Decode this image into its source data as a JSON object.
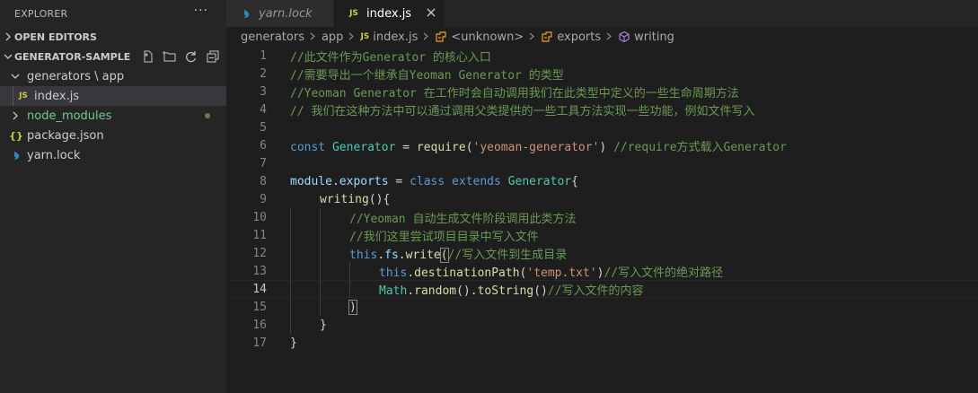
{
  "explorer": {
    "title": "EXPLORER",
    "more_label": "···",
    "open_editors_label": "OPEN EDITORS",
    "project_label": "GENERATOR-SAMPLE",
    "tree": {
      "generators_folder": "generators \\ app",
      "index_file": "index.js",
      "node_modules": "node_modules",
      "package_json": "package.json",
      "yarn_lock": "yarn.lock"
    }
  },
  "tabs": [
    {
      "label": "yarn.lock"
    },
    {
      "label": "index.js"
    }
  ],
  "breadcrumbs": {
    "generators": "generators",
    "app": "app",
    "file": "index.js",
    "unknown": "<unknown>",
    "exports": "exports",
    "writing": "writing"
  },
  "editor": {
    "current_line": 14,
    "lines": [
      {
        "n": "1"
      },
      {
        "n": "2"
      },
      {
        "n": "3"
      },
      {
        "n": "4"
      },
      {
        "n": "5"
      },
      {
        "n": "6"
      },
      {
        "n": "7"
      },
      {
        "n": "8"
      },
      {
        "n": "9"
      },
      {
        "n": "10"
      },
      {
        "n": "11"
      },
      {
        "n": "12"
      },
      {
        "n": "13"
      },
      {
        "n": "14"
      },
      {
        "n": "15"
      },
      {
        "n": "16"
      },
      {
        "n": "17"
      }
    ],
    "code": {
      "l1": "//此文件作为Generator 的核心入口",
      "l2": "//需要导出一个继承自Yeoman Generator 的类型",
      "l3": "//Yeoman Generator 在工作时会自动调用我们在此类型中定义的一些生命周期方法",
      "l4": "// 我们在这种方法中可以通过调用父类提供的一些工具方法实现一些功能，例如文件写入",
      "l6_const": "const",
      "l6_name": "Generator",
      "l6_eq": " = ",
      "l6_require": "require",
      "l6_open": "(",
      "l6_str": "'yeoman-generator'",
      "l6_close": ")",
      "l6_comment": " //require方式载入Generator",
      "l8_module": "module",
      "l8_dot": ".",
      "l8_exports": "exports",
      "l8_eq": " = ",
      "l8_class": "class",
      "l8_extends": " extends ",
      "l8_gen": "Generator",
      "l8_brace": "{",
      "l9_fn": "writing",
      "l9_rest": "(){",
      "l10": "//Yeoman 自动生成文件阶段调用此类方法",
      "l11": "//我们这里尝试项目目录中写入文件",
      "l12_this": "this",
      "l12_dot1": ".",
      "l12_fs": "fs",
      "l12_dot2": ".",
      "l12_write": "write",
      "l12_paren": "(",
      "l12_comment": "//写入文件到生成目录",
      "l13_this": "this",
      "l13_dot": ".",
      "l13_fn": "destinationPath",
      "l13_open": "(",
      "l13_str": "'temp.txt'",
      "l13_close": ")",
      "l13_comment": "//写入文件的绝对路径",
      "l14_math": "Math",
      "l14_dot1": ".",
      "l14_random": "random",
      "l14_parens": "().",
      "l14_tostring": "toString",
      "l14_parens2": "()",
      "l14_comment": "//写入文件的内容",
      "l15": ")",
      "l16": "}",
      "l17": "}"
    }
  },
  "colors": {
    "background": "#1e1e1e",
    "sidebar": "#252526",
    "comment": "#6a9955",
    "keyword": "#569cd6",
    "class": "#4ec9b0",
    "variable": "#9cdcfe",
    "function": "#dcdcaa",
    "string": "#ce9178"
  }
}
